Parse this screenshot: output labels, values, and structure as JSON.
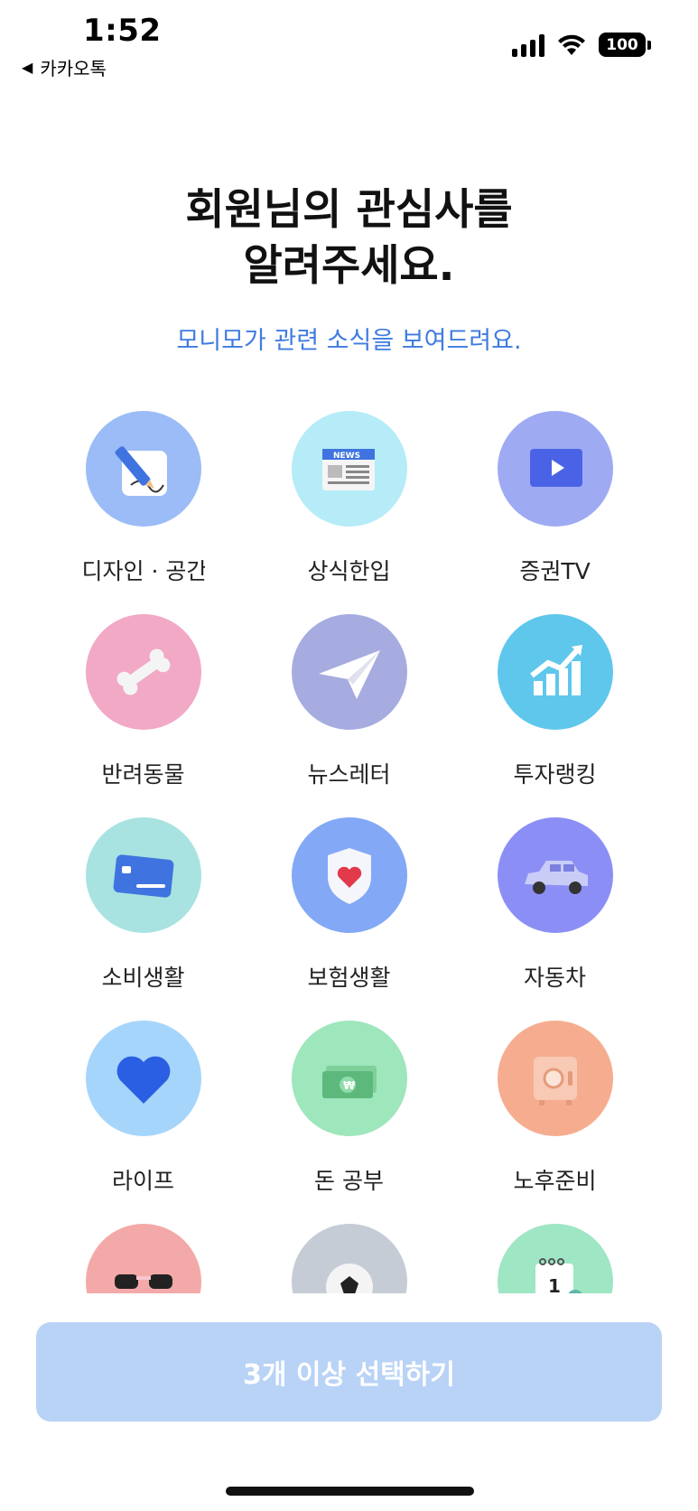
{
  "status_bar": {
    "time": "1:52",
    "back_app": "카카오톡",
    "battery": "100"
  },
  "header": {
    "title_line1": "회원님의 관심사를",
    "title_line2": "알려주세요.",
    "subtitle": "모니모가 관련 소식을 보여드려요."
  },
  "interests": [
    {
      "label": "디자인 · 공간",
      "icon": "pencil-paper-icon",
      "bg": "#9bbcf6"
    },
    {
      "label": "상식한입",
      "icon": "newspaper-icon",
      "bg": "#b5ecf8"
    },
    {
      "label": "증권TV",
      "icon": "video-play-icon",
      "bg": "#9eabf3"
    },
    {
      "label": "반려동물",
      "icon": "bone-icon",
      "bg": "#f1a9c6"
    },
    {
      "label": "뉴스레터",
      "icon": "paper-plane-icon",
      "bg": "#a6acdf"
    },
    {
      "label": "투자랭킹",
      "icon": "rising-chart-icon",
      "bg": "#5fc7ec"
    },
    {
      "label": "소비생활",
      "icon": "credit-card-icon",
      "bg": "#a8e3e1"
    },
    {
      "label": "보험생활",
      "icon": "shield-heart-icon",
      "bg": "#83a8f5"
    },
    {
      "label": "자동차",
      "icon": "car-icon",
      "bg": "#8b8ff5"
    },
    {
      "label": "라이프",
      "icon": "heart-icon",
      "bg": "#a6d5fb"
    },
    {
      "label": "돈 공부",
      "icon": "money-stack-icon",
      "bg": "#9ee6bb"
    },
    {
      "label": "노후준비",
      "icon": "safe-icon",
      "bg": "#f6ad8f"
    },
    {
      "label": "",
      "icon": "sunglasses-icon",
      "bg": "#f4a9a9"
    },
    {
      "label": "",
      "icon": "soccer-ball-icon",
      "bg": "#c6ccd6"
    },
    {
      "label": "",
      "icon": "calendar-icon",
      "bg": "#9fe6c4"
    }
  ],
  "cta": {
    "label": "3개 이상 선택하기"
  }
}
